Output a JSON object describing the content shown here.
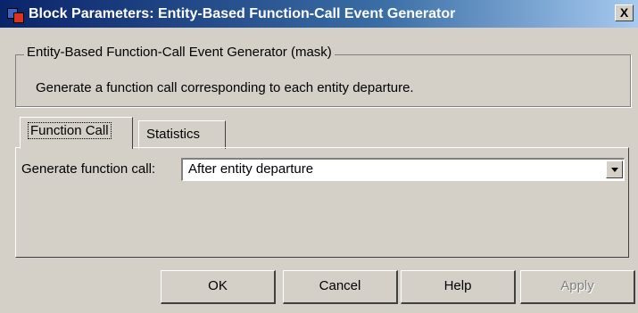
{
  "window": {
    "title": "Block Parameters: Entity-Based Function-Call Event Generator",
    "close_label": "X"
  },
  "mask": {
    "legend": "Entity-Based Function-Call Event Generator (mask)",
    "description": "Generate a function call corresponding to each entity departure."
  },
  "tabs": [
    {
      "label": "Function Call",
      "active": true
    },
    {
      "label": "Statistics",
      "active": false
    }
  ],
  "function_call": {
    "label": "Generate function call:",
    "value": "After entity departure"
  },
  "buttons": {
    "ok": "OK",
    "cancel": "Cancel",
    "help": "Help",
    "apply": "Apply"
  }
}
